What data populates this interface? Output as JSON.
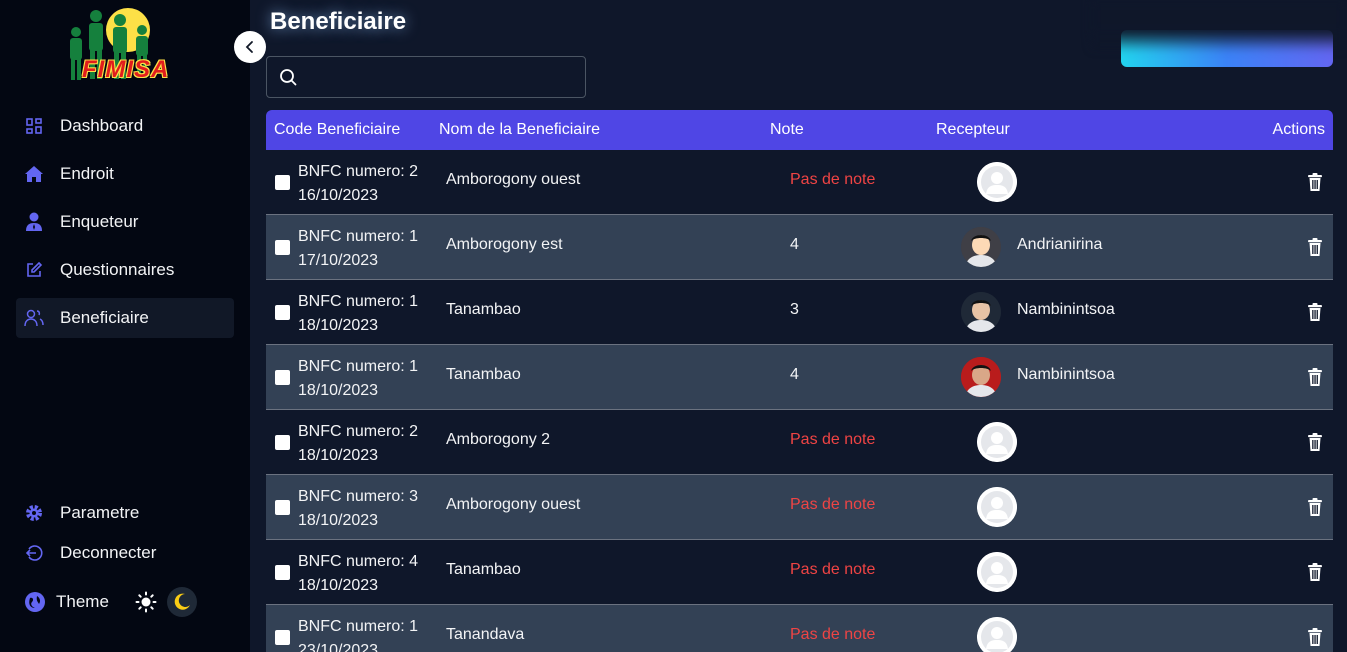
{
  "sidebar": {
    "logo_text": "FIMISA",
    "items": [
      {
        "label": "Dashboard",
        "icon": "dashboard-icon"
      },
      {
        "label": "Endroit",
        "icon": "home-icon"
      },
      {
        "label": "Enqueteur",
        "icon": "user-tie-icon"
      },
      {
        "label": "Questionnaires",
        "icon": "edit-icon"
      },
      {
        "label": "Beneficiaire",
        "icon": "users-icon",
        "active": true
      }
    ],
    "bottom": [
      {
        "label": "Parametre",
        "icon": "gear-icon"
      },
      {
        "label": "Deconnecter",
        "icon": "logout-icon"
      }
    ],
    "theme_label": "Theme"
  },
  "page": {
    "title": "Beneficiaire"
  },
  "search": {
    "value": "",
    "placeholder": ""
  },
  "table": {
    "headers": [
      "Code Beneficiaire",
      "Nom de la Beneficiaire",
      "Note",
      "Recepteur",
      "Actions"
    ],
    "rows": [
      {
        "code": "BNFC numero: 2",
        "date": "16/10/2023",
        "nom": "Amborogony ouest",
        "note": "Pas de note",
        "recepteur": "",
        "avatar": "default"
      },
      {
        "code": "BNFC numero: 1",
        "date": "17/10/2023",
        "nom": "Amborogony est",
        "note": "4",
        "recepteur": "Andrianirina",
        "avatar": "photo"
      },
      {
        "code": "BNFC numero: 1",
        "date": "18/10/2023",
        "nom": "Tanambao",
        "note": "3",
        "recepteur": "Nambinintsoa",
        "avatar": "photo"
      },
      {
        "code": "BNFC numero: 1",
        "date": "18/10/2023",
        "nom": "Tanambao",
        "note": "4",
        "recepteur": "Nambinintsoa",
        "avatar": "photo"
      },
      {
        "code": "BNFC numero: 2",
        "date": "18/10/2023",
        "nom": "Amborogony 2",
        "note": "Pas de note",
        "recepteur": "",
        "avatar": "default"
      },
      {
        "code": "BNFC numero: 3",
        "date": "18/10/2023",
        "nom": "Amborogony ouest",
        "note": "Pas de note",
        "recepteur": "",
        "avatar": "default"
      },
      {
        "code": "BNFC numero: 4",
        "date": "18/10/2023",
        "nom": "Tanambao",
        "note": "Pas de note",
        "recepteur": "",
        "avatar": "default"
      },
      {
        "code": "BNFC numero: 1",
        "date": "23/10/2023",
        "nom": "Tanandava",
        "note": "Pas de note",
        "recepteur": "",
        "avatar": "default"
      }
    ]
  },
  "colors": {
    "accent": "#4f46e5",
    "no_note": "#ef4444",
    "sidebar_bg": "#030712",
    "main_bg": "#0f172a",
    "row_alt": "#334155"
  }
}
